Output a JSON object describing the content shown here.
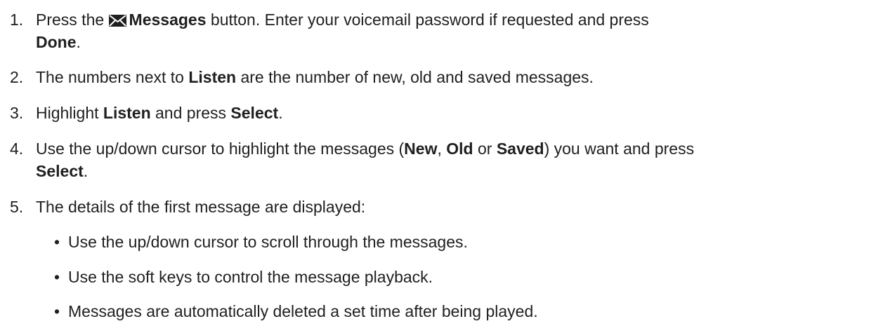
{
  "steps": [
    {
      "number": "1.",
      "parts": [
        {
          "text": "Press the ",
          "bold": false
        },
        {
          "icon": "envelope-icon"
        },
        {
          "text": "Messages",
          "bold": true
        },
        {
          "text": " button. Enter your voicemail password if requested and press ",
          "bold": false
        },
        {
          "text": "Done",
          "bold": true
        },
        {
          "text": ".",
          "bold": false
        }
      ],
      "line_break_before_index": 4
    },
    {
      "number": "2.",
      "parts": [
        {
          "text": "The numbers next to ",
          "bold": false
        },
        {
          "text": "Listen",
          "bold": true
        },
        {
          "text": " are the number of new, old and saved messages.",
          "bold": false
        }
      ]
    },
    {
      "number": "3.",
      "parts": [
        {
          "text": "Highlight ",
          "bold": false
        },
        {
          "text": "Listen",
          "bold": true
        },
        {
          "text": " and press ",
          "bold": false
        },
        {
          "text": "Select",
          "bold": true
        },
        {
          "text": ".",
          "bold": false
        }
      ]
    },
    {
      "number": "4.",
      "parts": [
        {
          "text": "Use the up/down cursor to highlight the messages (",
          "bold": false
        },
        {
          "text": "New",
          "bold": true
        },
        {
          "text": ", ",
          "bold": false
        },
        {
          "text": "Old",
          "bold": true
        },
        {
          "text": " or ",
          "bold": false
        },
        {
          "text": "Saved",
          "bold": true
        },
        {
          "text": ") you want and press ",
          "bold": false
        },
        {
          "text": "Select",
          "bold": true
        },
        {
          "text": ".",
          "bold": false
        }
      ],
      "line_break_before_index": 7
    },
    {
      "number": "5.",
      "parts": [
        {
          "text": "The details of the first message are displayed:",
          "bold": false
        }
      ]
    }
  ],
  "bullet_symbol": "•",
  "bullets": [
    "Use the up/down cursor to scroll through the messages.",
    "Use the soft keys to control the message playback.",
    "Messages are automatically deleted a set time after being played."
  ]
}
